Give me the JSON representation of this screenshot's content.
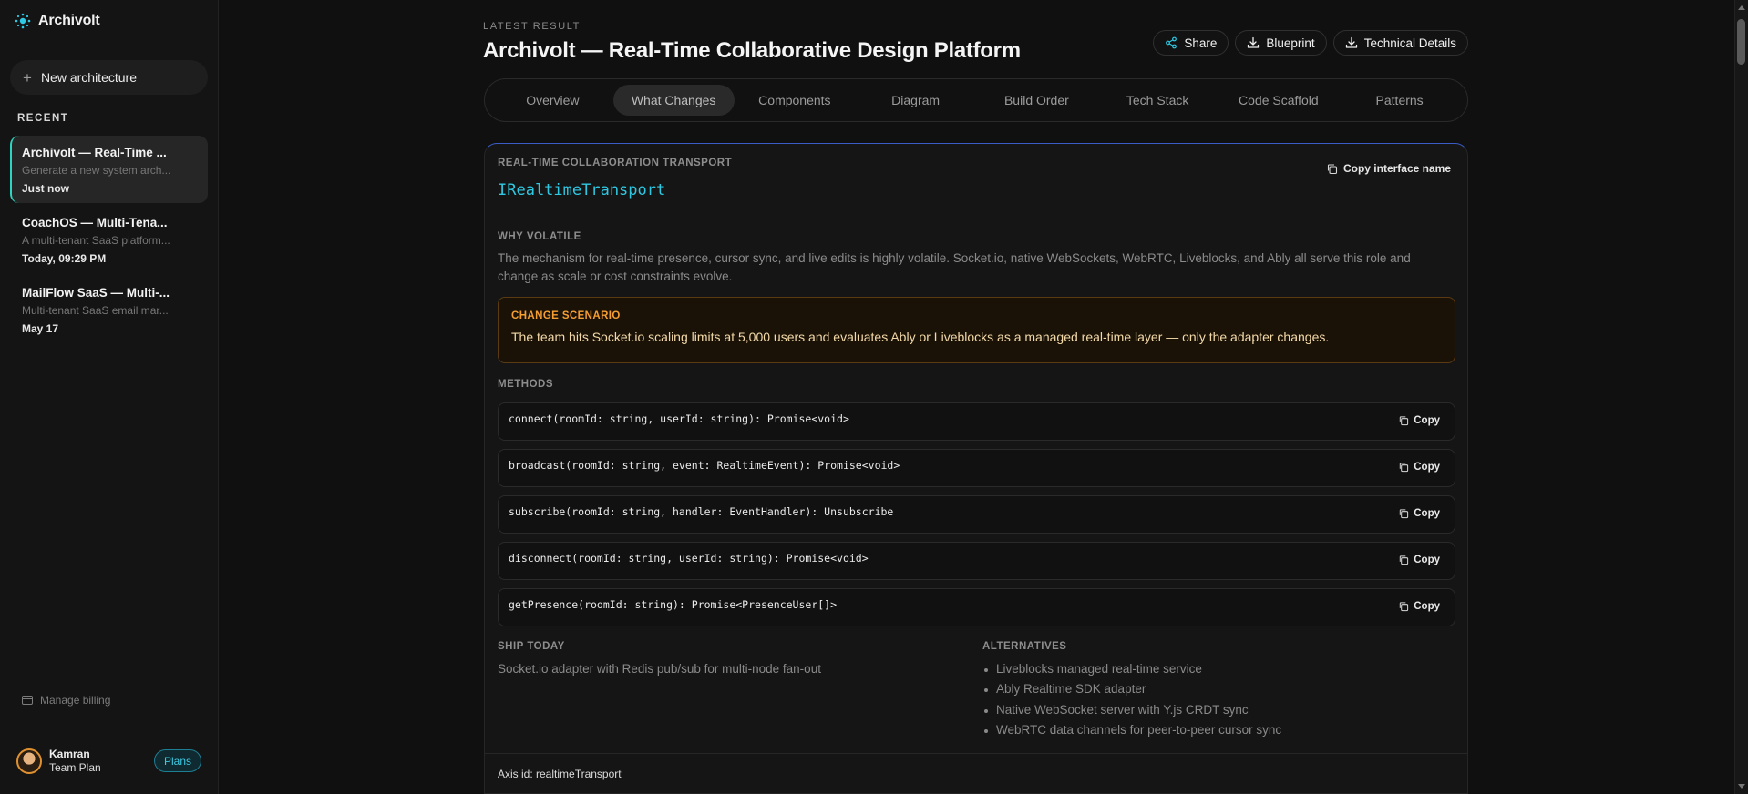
{
  "sidebar": {
    "brand": "Archivolt",
    "new_architecture": "New architecture",
    "recent_title": "RECENT",
    "recent": [
      {
        "title": "Archivolt — Real-Time ...",
        "desc": "Generate a new system arch...",
        "time": "Just now"
      },
      {
        "title": "CoachOS — Multi-Tena...",
        "desc": "A multi-tenant SaaS platform...",
        "time": "Today, 09:29 PM"
      },
      {
        "title": "MailFlow SaaS — Multi-...",
        "desc": "Multi-tenant SaaS email mar...",
        "time": "May 17"
      }
    ],
    "billing": "Manage billing",
    "user": {
      "name": "Kamran",
      "plan": "Team Plan",
      "plans_button": "Plans"
    }
  },
  "header": {
    "eyebrow": "LATEST RESULT",
    "title": "Archivolt — Real-Time Collaborative Design Platform",
    "actions": {
      "share": "Share",
      "blueprint": "Blueprint",
      "technical": "Technical Details"
    }
  },
  "tabs": [
    "Overview",
    "What Changes",
    "Components",
    "Diagram",
    "Build Order",
    "Tech Stack",
    "Code Scaffold",
    "Patterns"
  ],
  "active_tab": "What Changes",
  "card": {
    "section": "REAL-TIME COLLABORATION TRANSPORT",
    "interface": "IRealtimeTransport",
    "copy_interface": "Copy interface name",
    "why_label": "WHY VOLATILE",
    "why_text": "The mechanism for real-time presence, cursor sync, and live edits is highly volatile. Socket.io, native WebSockets, WebRTC, Liveblocks, and Ably all serve this role and change as scale or cost constraints evolve.",
    "scenario_label": "CHANGE SCENARIO",
    "scenario_text": "The team hits Socket.io scaling limits at 5,000 users and evaluates Ably or Liveblocks as a managed real-time layer — only the adapter changes.",
    "methods_label": "METHODS",
    "methods": [
      "connect(roomId: string, userId: string): Promise<void>",
      "broadcast(roomId: string, event: RealtimeEvent): Promise<void>",
      "subscribe(roomId: string, handler: EventHandler): Unsubscribe",
      "disconnect(roomId: string, userId: string): Promise<void>",
      "getPresence(roomId: string): Promise<PresenceUser[]>"
    ],
    "copy_label": "Copy",
    "ship_label": "SHIP TODAY",
    "ship_text": "Socket.io adapter with Redis pub/sub for multi-node fan-out",
    "alt_label": "ALTERNATIVES",
    "alternatives": [
      "Liveblocks managed real-time service",
      "Ably Realtime SDK adapter",
      "Native WebSocket server with Y.js CRDT sync",
      "WebRTC data channels for peer-to-peer cursor sync"
    ],
    "axis_id": "Axis id: realtimeTransport"
  },
  "colors": {
    "accent_cyan": "#2fc8e2",
    "scenario_orange": "#f59e32",
    "active_teal": "#2dd4bf"
  }
}
